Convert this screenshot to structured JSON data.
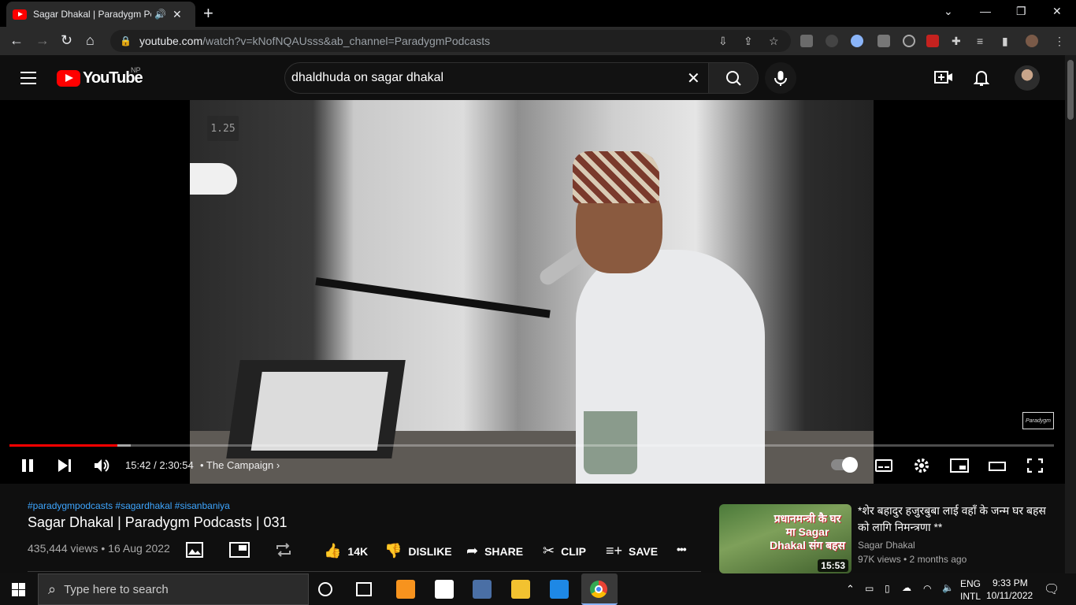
{
  "browser": {
    "tab_title": "Sagar Dhakal | Paradygm Po",
    "new_tab": "+",
    "url_host": "youtube.com",
    "url_path": "/watch?v=kNofNQAUsss&ab_channel=ParadygmPodcasts"
  },
  "masthead": {
    "logo_text": "YouTube",
    "region": "NP",
    "search_query": "dhaldhuda on sagar dhakal"
  },
  "player": {
    "speed_badge": "1.25",
    "current_time": "15:42 / 2:30:54",
    "chapter": "• The Campaign",
    "progress_fraction": 0.1036,
    "buffer_fraction": 0.116,
    "watermark": "Paradygm"
  },
  "video": {
    "hashtags": "#paradygmpodcasts #sagardhakal #sisanbaniya",
    "title": "Sagar Dhakal | Paradygm Podcasts | 031",
    "meta": "435,444 views • 16 Aug 2022",
    "like_count": "14K",
    "dislike_label": "DISLIKE",
    "share_label": "SHARE",
    "clip_label": "CLIP",
    "save_label": "SAVE",
    "more_label": "•••"
  },
  "recommendation": {
    "thumb_text": "प्रधानमन्त्री कै घर मा Sagar Dhakal संग बहस",
    "duration": "15:53",
    "title": "*शेर बहादुर हजुरबुबा लाई वहाँ के जन्म घर बहस को लागि निमन्त्रणा **",
    "channel": "Sagar Dhakal",
    "meta": "97K views • 2 months ago"
  },
  "taskbar": {
    "search_placeholder": "Type here to search",
    "lang_top": "ENG",
    "lang_bottom": "INTL",
    "time": "9:33 PM",
    "date": "10/11/2022"
  },
  "colors": {
    "youtube_red": "#ff0000",
    "link_blue": "#3ea6ff"
  }
}
